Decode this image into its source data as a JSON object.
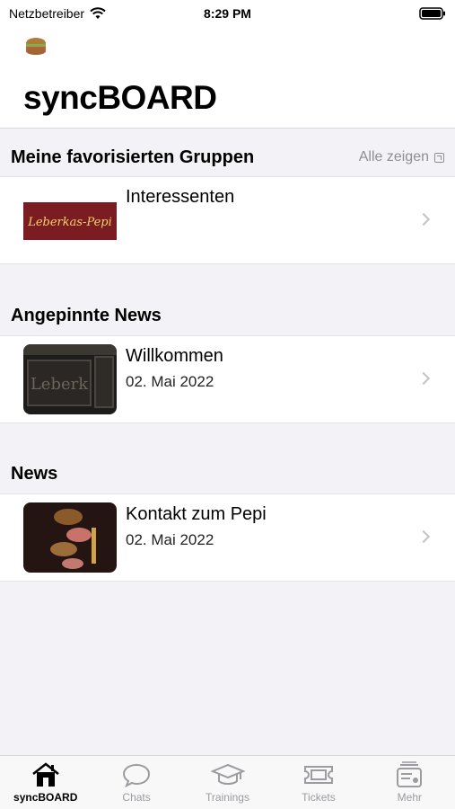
{
  "status_bar": {
    "carrier": "Netzbetreiber",
    "time": "8:29 PM"
  },
  "header": {
    "title": "syncBOARD"
  },
  "favorites": {
    "title": "Meine favorisierten Gruppen",
    "show_all": "Alle zeigen",
    "items": [
      {
        "title": "Interessenten",
        "logo_text": "Leberkas-Pepi"
      }
    ]
  },
  "pinned": {
    "title": "Angepinnte News",
    "items": [
      {
        "title": "Willkommen",
        "date": "02. Mai 2022"
      }
    ]
  },
  "news": {
    "title": "News",
    "items": [
      {
        "title": "Kontakt zum Pepi",
        "date": "02. Mai 2022"
      }
    ]
  },
  "tabs": [
    {
      "label": "syncBOARD",
      "icon": "home-icon",
      "active": true
    },
    {
      "label": "Chats",
      "icon": "chat-icon",
      "active": false
    },
    {
      "label": "Trainings",
      "icon": "graduation-cap-icon",
      "active": false
    },
    {
      "label": "Tickets",
      "icon": "ticket-icon",
      "active": false
    },
    {
      "label": "Mehr",
      "icon": "more-icon",
      "active": false
    }
  ],
  "colors": {
    "accent": "#000000",
    "inactive": "#9b9ba0",
    "logo_bg": "#7a1c22",
    "logo_text": "#f3d36a"
  }
}
